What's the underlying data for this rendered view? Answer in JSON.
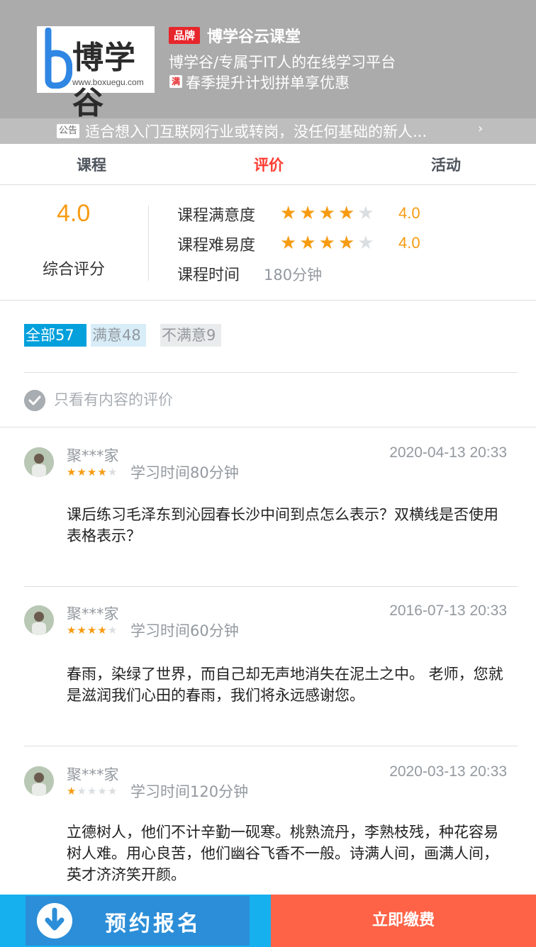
{
  "header": {
    "logo_name": "博学谷",
    "logo_url": "www.boxuegu.com",
    "brand_badge": "品牌",
    "brand_title": "博学谷云课堂",
    "slogan": "博学谷/专属于IT人的在线学习平台",
    "promo_badge": "满",
    "promo": "春季提升计划拼单享优惠",
    "notice_badge": "公告",
    "notice": "适合想入门互联网行业或转岗，没任何基础的新人...",
    "notice_chevron": "›"
  },
  "tabs": [
    {
      "label": "课程",
      "active": false
    },
    {
      "label": "评价",
      "active": true
    },
    {
      "label": "活动",
      "active": false
    }
  ],
  "summary": {
    "overall_score": "4.0",
    "overall_label": "综合评分",
    "metrics": [
      {
        "label": "课程满意度",
        "stars": 4,
        "value": "4.0"
      },
      {
        "label": "课程难易度",
        "stars": 4,
        "value": "4.0"
      }
    ],
    "time_label": "课程时间",
    "time_value": "180分钟"
  },
  "filters": {
    "all": "全部57",
    "satisfied": "满意48",
    "unsatisfied": "不满意9",
    "only_content": "只看有内容的评价"
  },
  "reviews": [
    {
      "name": "聚***家",
      "date": "2020-04-13 20:33",
      "stars": 4,
      "study_time": "学习时间80分钟",
      "body": "课后练习毛泽东到沁园春长沙中间到点怎么表示？双横线是否使用表格表示？"
    },
    {
      "name": "聚***家",
      "date": "2016-07-13 20:33",
      "stars": 4,
      "study_time": "学习时间60分钟",
      "body": "春雨，染绿了世界，而自己却无声地消失在泥土之中。 老师，您就是滋润我们心田的春雨，我们将永远感谢您。"
    },
    {
      "name": "聚***家",
      "date": "2020-03-13 20:33",
      "stars": 1,
      "study_time": "学习时间120分钟",
      "body": "立德树人，他们不计辛勤一砚寒。桃熟流丹，李熟枝残，种花容易树人难。用心良苦，他们幽谷飞香不一般。诗满人间，画满人间，英才济济笑开颜。"
    }
  ],
  "bottom": {
    "book_label": "预约报名",
    "pay_label": "立即缴费"
  },
  "colors": {
    "accent_orange": "#f79b11",
    "tab_active": "#ff3b30",
    "filter_active": "#03a0dc",
    "pay_button": "#ff6347",
    "divider": "#dbdee1",
    "muted_text": "#93999f"
  },
  "icons": {
    "promo": "discount-tag-icon",
    "notice": "announcement-icon",
    "only_content": "check-circle-icon",
    "book": "download-arrow-icon"
  }
}
